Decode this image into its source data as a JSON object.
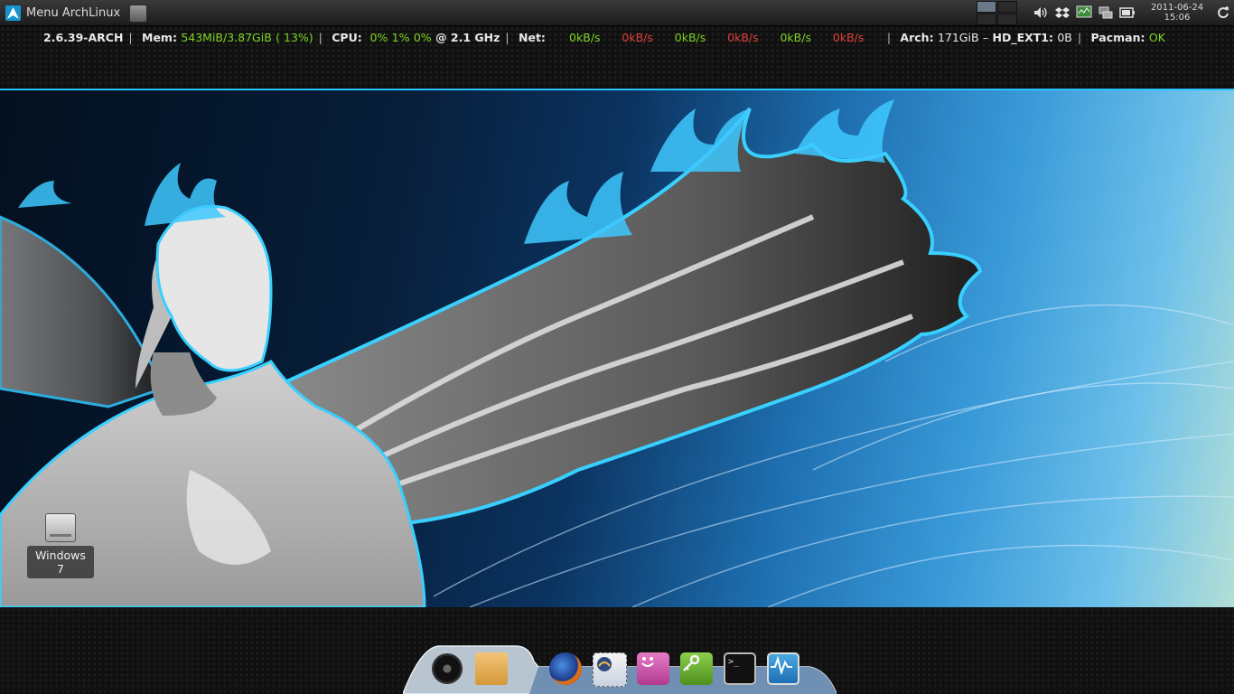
{
  "top_panel": {
    "menu_label": "Menu ArchLinux",
    "app_icon": "archive-manager-icon",
    "tray_icons": [
      "volume-icon",
      "dropbox-icon",
      "network-monitor-icon",
      "network-wired-icon",
      "battery-icon",
      "update-icon"
    ],
    "clock": {
      "date": "2011-06-24",
      "time": "15:06"
    }
  },
  "conky": {
    "kernel": "2.6.39-ARCH",
    "mem_label": "Mem:",
    "mem_used": "543MiB/3.87GiB",
    "mem_pct": "( 13%)",
    "cpu_label": "CPU:",
    "cpu_cores": [
      "0%",
      "1%",
      "0%"
    ],
    "cpu_freq": "@ 2.1 GHz",
    "net_label": "Net:",
    "net_rates": [
      "0kB/s",
      "0kB/s",
      "0kB/s",
      "0kB/s",
      "0kB/s",
      "0kB/s"
    ],
    "arch_label": "Arch:",
    "arch_value": "171GiB",
    "hd_label": "HD_EXT1:",
    "hd_value": "0B",
    "pacman_label": "Pacman:",
    "pacman_value": "OK"
  },
  "desktop": {
    "icons": [
      {
        "label": "Windows 7",
        "icon": "drive-icon"
      }
    ]
  },
  "dock": {
    "items": [
      "media-player-icon",
      "folder-icon",
      "firefox-icon",
      "mail-icon",
      "chat-icon",
      "keys-icon",
      "terminal-icon",
      "system-monitor-icon"
    ],
    "terminal_glyph": ">_"
  },
  "colors": {
    "accent_blue": "#29c4ff",
    "green": "#7dd321",
    "red": "#e0413b"
  }
}
